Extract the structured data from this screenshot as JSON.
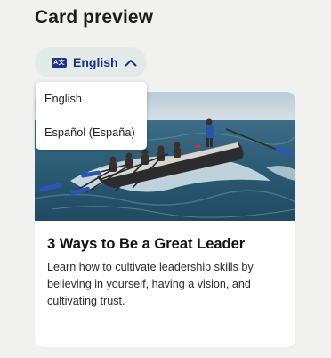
{
  "page": {
    "title": "Card preview"
  },
  "language_toggle": {
    "icon": "language-icon",
    "icon_text": "A文",
    "selected": "English"
  },
  "dropdown": {
    "options": [
      "English",
      "Español (España)"
    ]
  },
  "card": {
    "image": "rowing-boat-photo",
    "title": "3 Ways to Be a Great Leader",
    "description": "Learn how to cultivate leadership skills by believing in yourself, having a vision, and cultivating trust."
  }
}
